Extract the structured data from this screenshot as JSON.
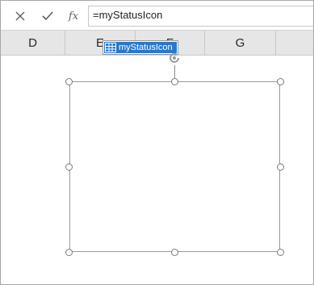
{
  "formula_bar": {
    "cancel_icon": "x-icon",
    "enter_icon": "checkmark-icon",
    "function_label": "fx",
    "formula_value": "=myStatusIcon"
  },
  "columns": [
    "D",
    "E",
    "F",
    "G",
    ""
  ],
  "autocomplete": {
    "item_icon": "named-range-table-icon",
    "item_label": "myStatusIcon"
  },
  "shape": {
    "rotate_icon": "rotate-icon",
    "handles": 8
  }
}
